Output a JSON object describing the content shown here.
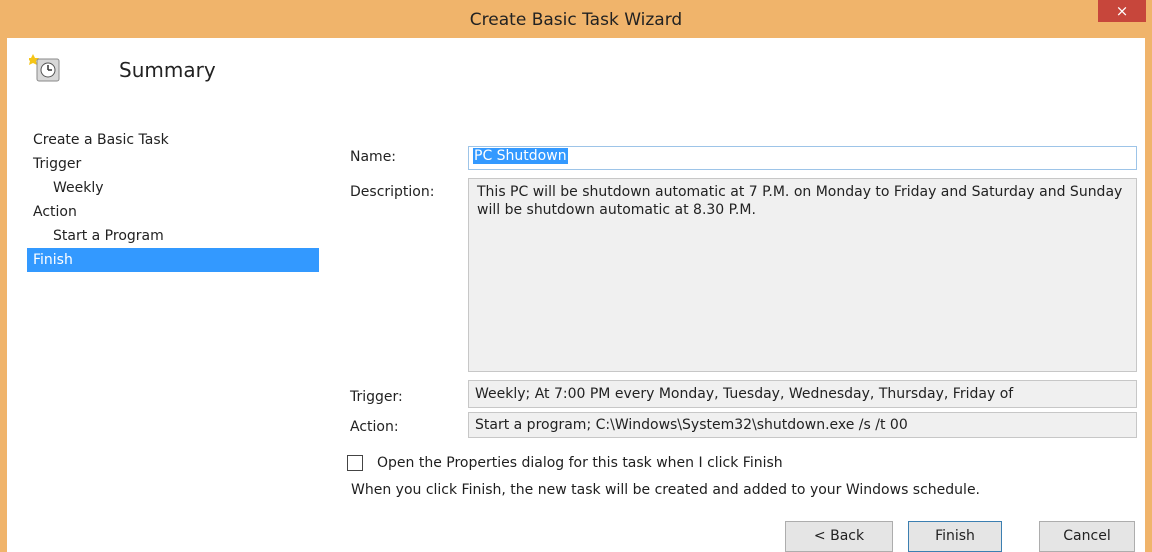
{
  "window": {
    "title": "Create Basic Task Wizard",
    "close_glyph": "×"
  },
  "header": {
    "title": "Summary",
    "icon": "task-clock-icon"
  },
  "sidebar": {
    "items": [
      {
        "label": "Create a Basic Task",
        "indent": false,
        "active": false
      },
      {
        "label": "Trigger",
        "indent": false,
        "active": false
      },
      {
        "label": "Weekly",
        "indent": true,
        "active": false
      },
      {
        "label": "Action",
        "indent": false,
        "active": false
      },
      {
        "label": "Start a Program",
        "indent": true,
        "active": false
      },
      {
        "label": "Finish",
        "indent": false,
        "active": true
      }
    ]
  },
  "form": {
    "name_label": "Name:",
    "name_value": "PC Shutdown",
    "description_label": "Description:",
    "description_value": "This PC will be shutdown automatic at 7 P.M.  on Monday to Friday and Saturday and Sunday will be shutdown automatic at 8.30 P.M.",
    "trigger_label": "Trigger:",
    "trigger_value": "Weekly; At 7:00 PM every Monday, Tuesday, Wednesday, Thursday, Friday of",
    "action_label": "Action:",
    "action_value": "Start a program; C:\\Windows\\System32\\shutdown.exe /s /t 00"
  },
  "options": {
    "open_properties_label": "Open the Properties dialog for this task when I click Finish",
    "open_properties_checked": false,
    "info_text": "When you click Finish, the new task will be created and added to your Windows schedule."
  },
  "buttons": {
    "back": "< Back",
    "finish": "Finish",
    "cancel": "Cancel"
  },
  "colors": {
    "title_bar": "#f0b46b",
    "close_button": "#c7463b",
    "selection": "#3399ff"
  }
}
